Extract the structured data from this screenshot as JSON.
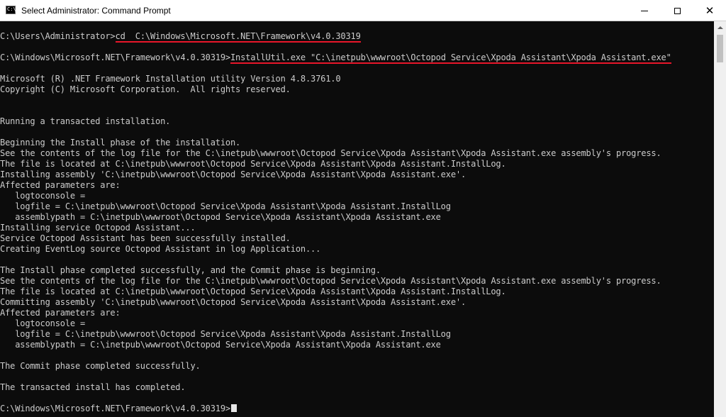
{
  "window": {
    "title": "Select Administrator: Command Prompt",
    "icon_text": "C:\\",
    "minimize_icon": "minimize-icon",
    "maximize_icon": "maximize-icon",
    "close_symbol": "✕"
  },
  "console": {
    "lines": [
      {
        "text": "C:\\Users\\Administrator>",
        "u": "cd  C:\\Windows\\Microsoft.NET\\Framework\\v4.0.30319"
      },
      {
        "text": ""
      },
      {
        "text": "C:\\Windows\\Microsoft.NET\\Framework\\v4.0.30319>",
        "u": "InstallUtil.exe \"C:\\inetpub\\wwwroot\\Octopod Service\\Xpoda Assistant\\Xpoda Assistant.exe\""
      },
      {
        "text": ""
      },
      {
        "text": "Microsoft (R) .NET Framework Installation utility Version 4.8.3761.0"
      },
      {
        "text": "Copyright (C) Microsoft Corporation.  All rights reserved."
      },
      {
        "text": ""
      },
      {
        "text": ""
      },
      {
        "text": "Running a transacted installation."
      },
      {
        "text": ""
      },
      {
        "text": "Beginning the Install phase of the installation."
      },
      {
        "text": "See the contents of the log file for the C:\\inetpub\\wwwroot\\Octopod Service\\Xpoda Assistant\\Xpoda Assistant.exe assembly's progress."
      },
      {
        "text": "The file is located at C:\\inetpub\\wwwroot\\Octopod Service\\Xpoda Assistant\\Xpoda Assistant.InstallLog."
      },
      {
        "text": "Installing assembly 'C:\\inetpub\\wwwroot\\Octopod Service\\Xpoda Assistant\\Xpoda Assistant.exe'."
      },
      {
        "text": "Affected parameters are:"
      },
      {
        "text": "   logtoconsole ="
      },
      {
        "text": "   logfile = C:\\inetpub\\wwwroot\\Octopod Service\\Xpoda Assistant\\Xpoda Assistant.InstallLog"
      },
      {
        "text": "   assemblypath = C:\\inetpub\\wwwroot\\Octopod Service\\Xpoda Assistant\\Xpoda Assistant.exe"
      },
      {
        "text": "Installing service Octopod Assistant..."
      },
      {
        "text": "Service Octopod Assistant has been successfully installed."
      },
      {
        "text": "Creating EventLog source Octopod Assistant in log Application..."
      },
      {
        "text": ""
      },
      {
        "text": "The Install phase completed successfully, and the Commit phase is beginning."
      },
      {
        "text": "See the contents of the log file for the C:\\inetpub\\wwwroot\\Octopod Service\\Xpoda Assistant\\Xpoda Assistant.exe assembly's progress."
      },
      {
        "text": "The file is located at C:\\inetpub\\wwwroot\\Octopod Service\\Xpoda Assistant\\Xpoda Assistant.InstallLog."
      },
      {
        "text": "Committing assembly 'C:\\inetpub\\wwwroot\\Octopod Service\\Xpoda Assistant\\Xpoda Assistant.exe'."
      },
      {
        "text": "Affected parameters are:"
      },
      {
        "text": "   logtoconsole ="
      },
      {
        "text": "   logfile = C:\\inetpub\\wwwroot\\Octopod Service\\Xpoda Assistant\\Xpoda Assistant.InstallLog"
      },
      {
        "text": "   assemblypath = C:\\inetpub\\wwwroot\\Octopod Service\\Xpoda Assistant\\Xpoda Assistant.exe"
      },
      {
        "text": ""
      },
      {
        "text": "The Commit phase completed successfully."
      },
      {
        "text": ""
      },
      {
        "text": "The transacted install has completed."
      },
      {
        "text": ""
      },
      {
        "text": "C:\\Windows\\Microsoft.NET\\Framework\\v4.0.30319>",
        "cursor": true
      }
    ]
  },
  "colors": {
    "background": "#0c0c0c",
    "text": "#cccccc",
    "underline": "#e8162a"
  }
}
